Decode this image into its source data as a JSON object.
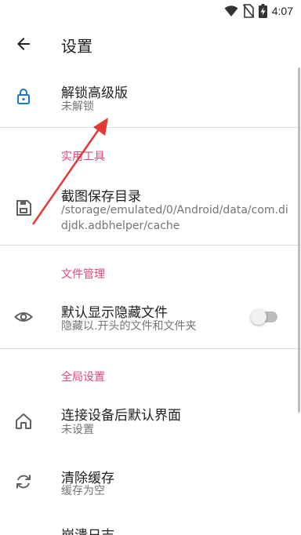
{
  "statusbar": {
    "time": "4:07"
  },
  "header": {
    "title": "设置"
  },
  "items": {
    "unlock": {
      "title": "解锁高级版",
      "subtitle": "未解锁"
    },
    "section_tools": "实用工具",
    "screenshot_dir": {
      "title": "截图保存目录",
      "subtitle": "/storage/emulated/0/Android/data/com.didjdk.adbhelper/cache"
    },
    "section_files": "文件管理",
    "show_hidden": {
      "title": "默认显示隐藏文件",
      "subtitle": "隐藏以.开头的文件和文件夹",
      "enabled": false
    },
    "section_global": "全局设置",
    "default_view": {
      "title": "连接设备后默认界面",
      "subtitle": "未设置"
    },
    "clear_cache": {
      "title": "清除缓存",
      "subtitle": "缓存为空"
    },
    "crash_log": {
      "title": "崩溃日志"
    }
  },
  "colors": {
    "accent": "#e0457b",
    "icon_blue": "#1976d2",
    "annotation_red": "#e53935"
  }
}
